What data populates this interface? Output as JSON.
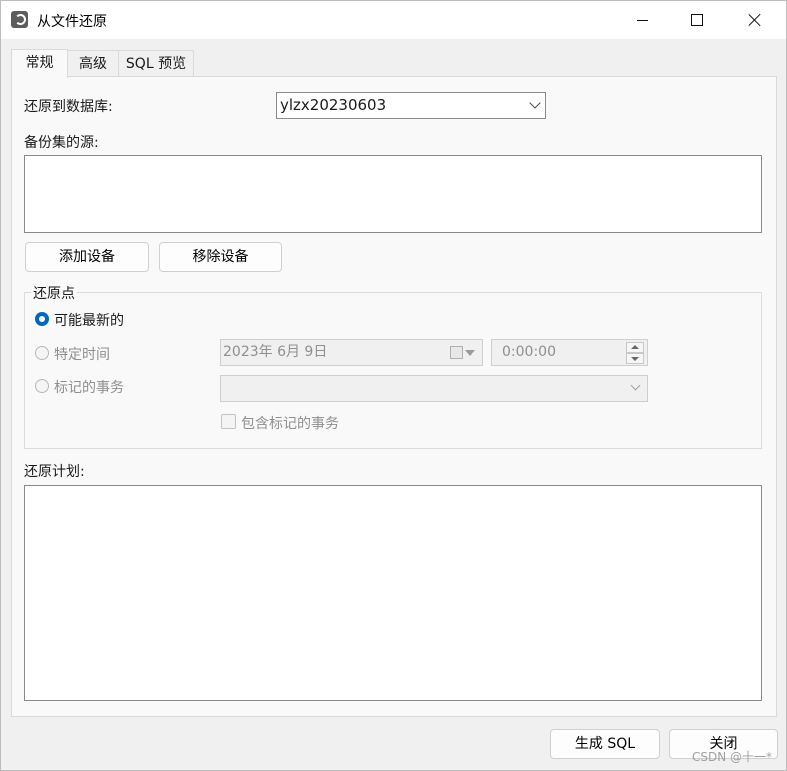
{
  "window": {
    "title": "从文件还原"
  },
  "tabs": [
    {
      "label": "常规",
      "active": true
    },
    {
      "label": "高级",
      "active": false
    },
    {
      "label": "SQL 预览",
      "active": false
    }
  ],
  "general": {
    "restore_to_db_label": "还原到数据库:",
    "restore_to_db_value": "ylzx20230603",
    "backup_source_label": "备份集的源:",
    "add_device_button": "添加设备",
    "remove_device_button": "移除设备",
    "restore_point": {
      "legend": "还原点",
      "options": [
        {
          "label": "可能最新的",
          "selected": true,
          "enabled": true
        },
        {
          "label": "特定时间",
          "selected": false,
          "enabled": false
        },
        {
          "label": "标记的事务",
          "selected": false,
          "enabled": false
        }
      ],
      "date_value": "2023年  6月  9日",
      "time_value": "0:00:00",
      "marked_tx_value": "",
      "include_marked_label": "包含标记的事务",
      "include_marked_checked": false
    },
    "restore_plan_label": "还原计划:"
  },
  "footer": {
    "generate_sql_button": "生成 SQL",
    "close_button": "关闭",
    "watermark": "CSDN @十一*"
  },
  "colors": {
    "accent": "#0067c0",
    "panel_bg": "#f9f9f9",
    "window_bg": "#f0f0f0"
  }
}
